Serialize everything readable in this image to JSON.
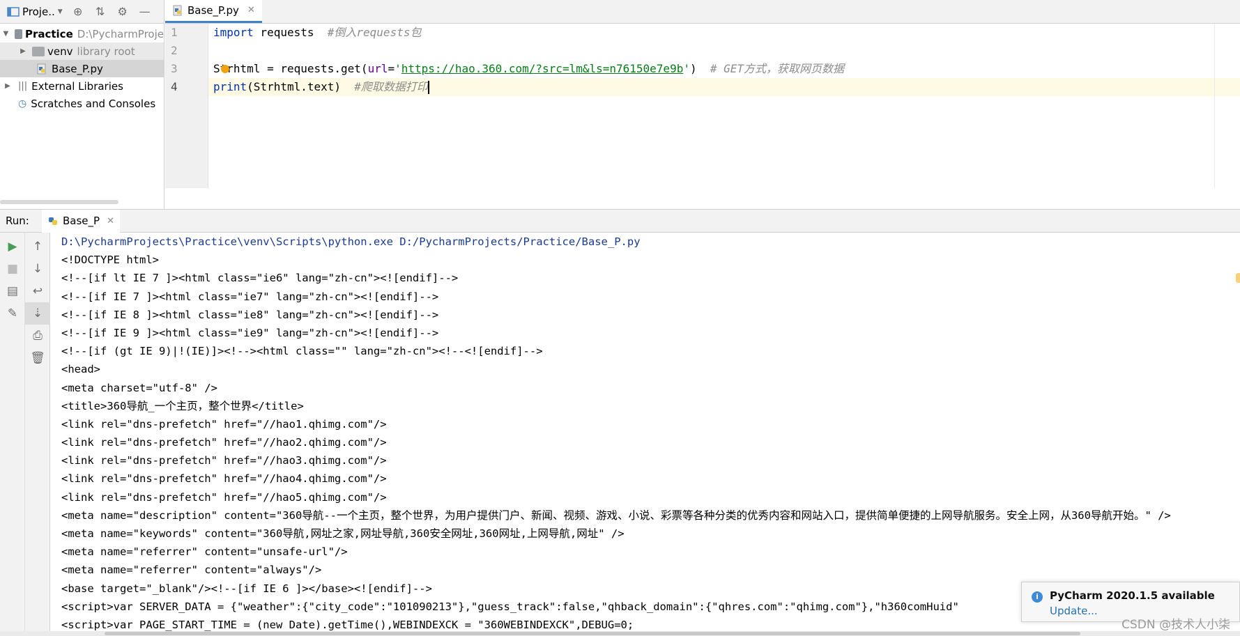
{
  "project_panel": {
    "title": "Proje..",
    "tree": [
      {
        "label": "Practice",
        "note": "D:\\PycharmProje"
      },
      {
        "label": "venv",
        "note": "library root"
      },
      {
        "label": "Base_P.py",
        "note": ""
      },
      {
        "label": "External Libraries",
        "note": ""
      },
      {
        "label": "Scratches and Consoles",
        "note": ""
      }
    ]
  },
  "editor": {
    "tab_label": "Base_P.py",
    "line_numbers": [
      "1",
      "2",
      "3",
      "4"
    ],
    "lines": [
      {
        "kw": "import",
        "rest": " requests  ",
        "comment": "#倒入requests包"
      },
      {
        "empty": ""
      },
      {
        "pre": "Strhtml = requests.get(",
        "param": "url",
        "eq": "=",
        "q1": "'",
        "url": "https://hao.360.com/?src=lm&ls=n76150e7e9b",
        "q2": "'",
        "post": ")  ",
        "comment": "# GET方式，获取网页数据"
      },
      {
        "kw": "print",
        "rest": "(Strhtml.text)  ",
        "comment": "#爬取数据打印"
      }
    ]
  },
  "run_panel": {
    "label": "Run:",
    "tab_label": "Base_P",
    "console_lines": [
      "D:\\PycharmProjects\\Practice\\venv\\Scripts\\python.exe D:/PycharmProjects/Practice/Base_P.py",
      "<!DOCTYPE html>",
      "<!--[if lt IE 7 ]><html class=\"ie6\" lang=\"zh-cn\"><![endif]-->",
      "<!--[if IE 7 ]><html class=\"ie7\" lang=\"zh-cn\"><![endif]-->",
      "<!--[if IE 8 ]><html class=\"ie8\" lang=\"zh-cn\"><![endif]-->",
      "<!--[if IE 9 ]><html class=\"ie9\" lang=\"zh-cn\"><![endif]-->",
      "<!--[if (gt IE 9)|!(IE)]><!--><html class=\"\" lang=\"zh-cn\"><!--<![endif]-->",
      "<head>",
      "<meta charset=\"utf-8\" />",
      "<title>360导航_一个主页，整个世界</title>",
      "<link rel=\"dns-prefetch\" href=\"//hao1.qhimg.com\"/>",
      "<link rel=\"dns-prefetch\" href=\"//hao2.qhimg.com\"/>",
      "<link rel=\"dns-prefetch\" href=\"//hao3.qhimg.com\"/>",
      "<link rel=\"dns-prefetch\" href=\"//hao4.qhimg.com\"/>",
      "<link rel=\"dns-prefetch\" href=\"//hao5.qhimg.com\"/>",
      "<meta name=\"description\" content=\"360导航--一个主页，整个世界，为用户提供门户、新闻、视频、游戏、小说、彩票等各种分类的优秀内容和网站入口，提供简单便捷的上网导航服务。安全上网，从360导航开始。\" />",
      "<meta name=\"keywords\" content=\"360导航,网址之家,网址导航,360安全网址,360网址,上网导航,网址\" />",
      "<meta name=\"referrer\" content=\"unsafe-url\"/>",
      "<meta name=\"referrer\" content=\"always\"/>",
      "<base target=\"_blank\"/><!--[if IE 6 ]></base><![endif]-->",
      "<script>var SERVER_DATA = {\"weather\":{\"city_code\":\"101090213\"},\"guess_track\":false,\"qhback_domain\":{\"qhres.com\":\"qhimg.com\"},\"h360comHuid\"",
      "<script>var PAGE_START_TIME = (new Date).getTime(),WEBINDEXCK = \"360WEBINDEXCK\",DEBUG=0;"
    ]
  },
  "notification": {
    "title": "PyCharm 2020.1.5 available",
    "link": "Update..."
  },
  "watermark": "CSDN @技术人小柒"
}
